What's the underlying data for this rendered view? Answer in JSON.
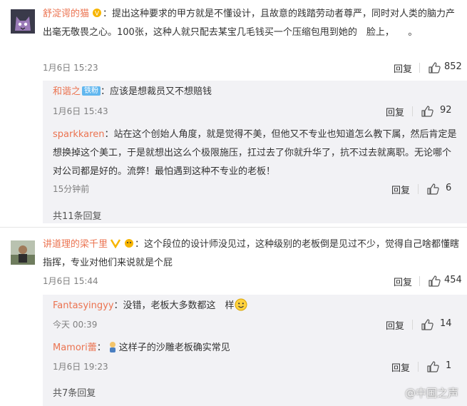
{
  "comments": [
    {
      "username": "舒淀谔的猫",
      "colon": "：",
      "text": "提出这种要求的甲方就是不懂设计，且故意的践踏劳动者尊严，同时对人类的脑力产出毫无敬畏之心。100张，这种人就只配去某宝几毛钱买一个压缩包甩到她的　脸上，　　。",
      "time": "1月6日 15:23",
      "reply_label": "回复",
      "likes": "852",
      "replies": [
        {
          "username": "和谐之",
          "badge": "铁粉",
          "colon": "：",
          "text": "应该是想裁员又不想赔钱",
          "time": "1月6日 15:43",
          "reply_label": "回复",
          "likes": "92"
        },
        {
          "username": "sparkkaren",
          "colon": "：",
          "text": "站在这个创始人角度，就是觉得不美，但他又不专业也知道怎么教下属，然后肯定是想换掉这个美工，于是就想出这么个极限施压，扛过去了你就升华了，抗不过去就离职。无论哪个对公司都是好的。流弊！最怕遇到这种不专业的老板！",
          "time": "15分钟前",
          "reply_label": "回复",
          "likes": "6"
        }
      ],
      "more": "共11条回复"
    },
    {
      "username": "讲道理的梁千里",
      "colon": "：",
      "text": "这个段位的设计师没见过，这种级别的老板倒是见过不少，觉得自己啥都懂瞎指挥，专业对他们来说就是个屁",
      "time": "1月6日 15:44",
      "reply_label": "回复",
      "likes": "454",
      "replies": [
        {
          "username": "Fantasyingyy",
          "colon": "：",
          "text": "没错，老板大多数都这　样",
          "time": "今天 00:39",
          "reply_label": "回复",
          "likes": "14"
        },
        {
          "username": "Mamori蕾",
          "colon": "：",
          "text": "这样子的沙雕老板确实常见",
          "time": "1月6日 19:23",
          "reply_label": "回复",
          "likes": "1"
        }
      ],
      "more": "共7条回复"
    }
  ],
  "watermark": "@中国之声",
  "colors": {
    "username": "#eb7350",
    "reply_bg": "#f2f2f5",
    "time": "#808080"
  },
  "icons": [
    "thumbs-up-icon",
    "smiley-icon",
    "vip-icon",
    "emoji-icon"
  ]
}
